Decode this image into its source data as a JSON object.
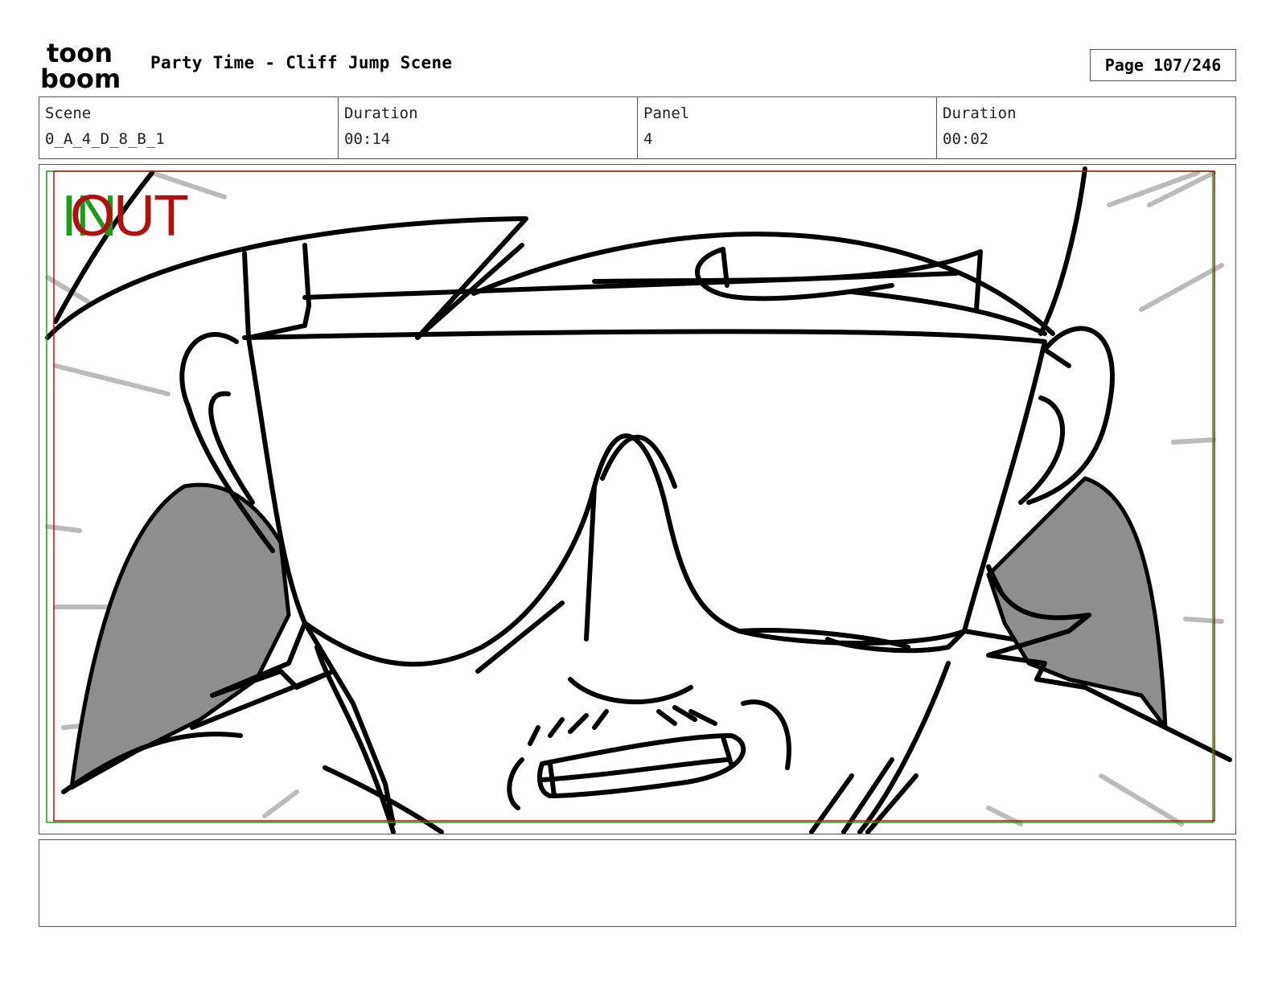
{
  "header": {
    "logo_text_top": "toon",
    "logo_text_bottom": "boom",
    "title": "Party Time - Cliff Jump Scene",
    "page": "Page 107/246"
  },
  "info": {
    "scene_label": "Scene",
    "scene_value": "0_A_4_D_8_B_1",
    "scene_duration_label": "Duration",
    "scene_duration_value": "00:14",
    "panel_label": "Panel",
    "panel_value": "4",
    "panel_duration_label": "Duration",
    "panel_duration_value": "00:02"
  },
  "panel": {
    "in_marker": "IN",
    "out_marker": "OUT",
    "in_color": "#1a9e1a",
    "out_color": "#b01010"
  },
  "notes": {
    "text": ""
  }
}
